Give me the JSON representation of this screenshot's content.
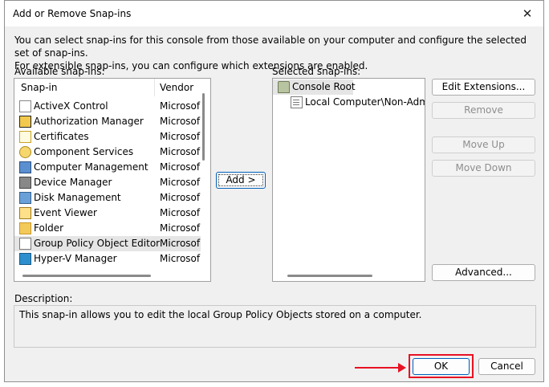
{
  "window": {
    "title": "Add or Remove Snap-ins"
  },
  "intro": {
    "line1": "You can select snap-ins for this console from those available on your computer and configure the selected set of snap-ins.",
    "line2": "For extensible snap-ins, you can configure which extensions are enabled."
  },
  "available": {
    "label": "Available snap-ins:",
    "col_snapin": "Snap-in",
    "col_vendor": "Vendor",
    "items": [
      {
        "name": "ActiveX Control",
        "vendor": "Microsof",
        "icon": "activex-icon"
      },
      {
        "name": "Authorization Manager",
        "vendor": "Microsof",
        "icon": "authorization-icon"
      },
      {
        "name": "Certificates",
        "vendor": "Microsof",
        "icon": "certificate-icon"
      },
      {
        "name": "Component Services",
        "vendor": "Microsof",
        "icon": "component-icon"
      },
      {
        "name": "Computer Management",
        "vendor": "Microsof",
        "icon": "computer-management-icon"
      },
      {
        "name": "Device Manager",
        "vendor": "Microsof",
        "icon": "device-manager-icon"
      },
      {
        "name": "Disk Management",
        "vendor": "Microsof",
        "icon": "disk-icon"
      },
      {
        "name": "Event Viewer",
        "vendor": "Microsof",
        "icon": "event-viewer-icon"
      },
      {
        "name": "Folder",
        "vendor": "Microsof",
        "icon": "folder-icon"
      },
      {
        "name": "Group Policy Object Editor",
        "vendor": "Microsof",
        "icon": "group-policy-icon"
      },
      {
        "name": "Hyper-V Manager",
        "vendor": "Microsof",
        "icon": "hyperv-icon"
      }
    ]
  },
  "add_button": "Add >",
  "selected": {
    "label": "Selected snap-ins:",
    "root": "Console Root",
    "child": "Local Computer\\Non-Admin"
  },
  "buttons": {
    "edit_extensions": "Edit Extensions...",
    "remove": "Remove",
    "move_up": "Move Up",
    "move_down": "Move Down",
    "advanced": "Advanced...",
    "ok": "OK",
    "cancel": "Cancel"
  },
  "description": {
    "label": "Description:",
    "text": "This snap-in allows you to edit the local Group Policy Objects stored on a computer."
  },
  "colors": {
    "highlight": "#e81123",
    "accent": "#005fb8",
    "selected_row": "#e5e5e5"
  }
}
